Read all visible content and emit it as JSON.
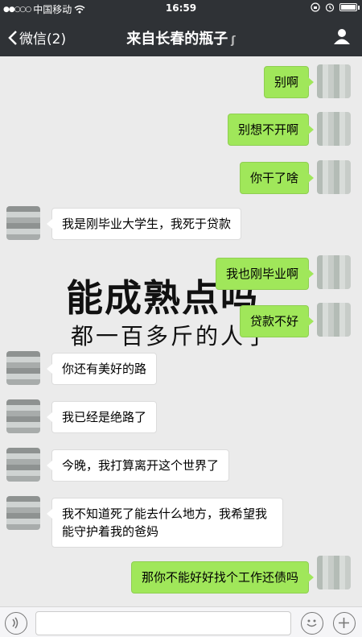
{
  "status_bar": {
    "signal_dots": "●●○○○",
    "carrier": "中国移动",
    "time": "16:59"
  },
  "nav": {
    "back_label": "微信(2)",
    "title": "来自长春的瓶子"
  },
  "messages": [
    {
      "side": "me",
      "text": "别啊"
    },
    {
      "side": "me",
      "text": "别想不开啊"
    },
    {
      "side": "me",
      "text": "你干了啥"
    },
    {
      "side": "them",
      "text": "我是刚毕业大学生，我死于贷款"
    },
    {
      "side": "me",
      "text": "我也刚毕业啊"
    },
    {
      "side": "me",
      "text": "贷款不好"
    },
    {
      "side": "them",
      "text": "你还有美好的路"
    },
    {
      "side": "them",
      "text": "我已经是绝路了"
    },
    {
      "side": "them",
      "text": "今晚，我打算离开这个世界了"
    },
    {
      "side": "them",
      "text": "我不知道死了能去什么地方，我希望我能守护着我的爸妈"
    },
    {
      "side": "me",
      "text": "那你不能好好找个工作还债吗"
    }
  ],
  "sticker": {
    "main": "能成熟点吗",
    "sub": "都一百多斤的人了"
  },
  "icons": {
    "back": "chevron-left-icon",
    "profile": "person-icon",
    "voice": "voice-icon",
    "emoji": "emoji-icon",
    "plus": "plus-icon"
  },
  "colors": {
    "header_bg": "#2f3236",
    "chat_bg": "#ebebeb",
    "my_bubble": "#a0e75a",
    "their_bubble": "#ffffff"
  }
}
